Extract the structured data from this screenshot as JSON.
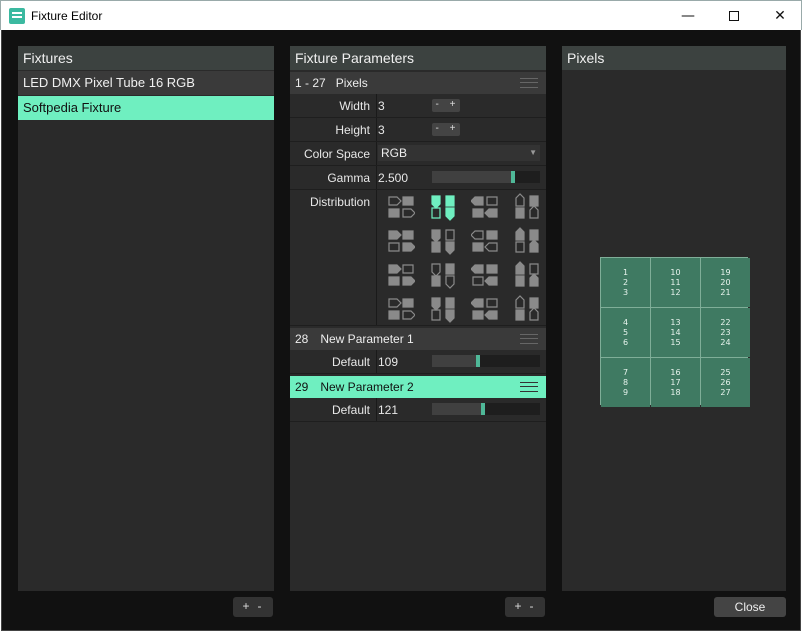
{
  "window": {
    "title": "Fixture Editor"
  },
  "fixtures": {
    "header": "Fixtures",
    "items": [
      {
        "label": "LED DMX Pixel Tube 16 RGB"
      },
      {
        "label": "Softpedia Fixture"
      }
    ],
    "add_label": "+",
    "remove_label": "-"
  },
  "parameters": {
    "header": "Fixture Parameters",
    "group1": {
      "range": "1 - 27",
      "name": "Pixels",
      "width_label": "Width",
      "width_value": "3",
      "height_label": "Height",
      "height_value": "3",
      "colorspace_label": "Color Space",
      "colorspace_value": "RGB",
      "gamma_label": "Gamma",
      "gamma_value": "2.500",
      "gamma_fraction": 0.75,
      "distribution_label": "Distribution",
      "stepper_label": "- +"
    },
    "group2": {
      "num": "28",
      "name": "New Parameter 1",
      "default_label": "Default",
      "default_value": "109",
      "fraction": 0.43
    },
    "group3": {
      "num": "29",
      "name": "New Parameter 2",
      "default_label": "Default",
      "default_value": "121",
      "fraction": 0.47
    },
    "add_label": "+",
    "remove_label": "-"
  },
  "pixels": {
    "header": "Pixels",
    "cells": [
      [
        "1",
        "2",
        "3"
      ],
      [
        "10",
        "11",
        "12"
      ],
      [
        "19",
        "20",
        "21"
      ],
      [
        "4",
        "5",
        "6"
      ],
      [
        "13",
        "14",
        "15"
      ],
      [
        "22",
        "23",
        "24"
      ],
      [
        "7",
        "8",
        "9"
      ],
      [
        "16",
        "17",
        "18"
      ],
      [
        "25",
        "26",
        "27"
      ]
    ]
  },
  "close_label": "Close",
  "colors": {
    "accent": "#6fefc0",
    "pixel_cell": "#3f7a62",
    "slider_knob": "#4fb898"
  }
}
